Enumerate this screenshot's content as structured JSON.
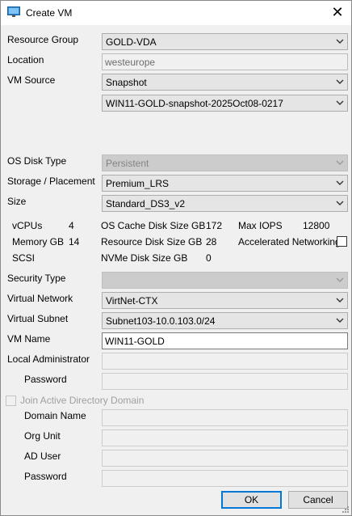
{
  "window": {
    "title": "Create VM",
    "close_glyph": "✕"
  },
  "labels": {
    "resource_group": "Resource Group",
    "location": "Location",
    "vm_source": "VM Source",
    "os_disk_type": "OS Disk Type",
    "storage_placement": "Storage / Placement",
    "size": "Size",
    "security_type": "Security Type",
    "virtual_network": "Virtual Network",
    "virtual_subnet": "Virtual Subnet",
    "vm_name": "VM Name",
    "local_admin": "Local Administrator",
    "password": "Password",
    "join_ad": "Join Active Directory Domain",
    "domain_name": "Domain Name",
    "org_unit": "Org Unit",
    "ad_user": "AD User",
    "ad_password": "Password"
  },
  "fields": {
    "resource_group": "GOLD-VDA",
    "location": "westeurope",
    "vm_source": "Snapshot",
    "snapshot": "WIN11-GOLD-snapshot-2025Oct08-0217",
    "os_disk_type": "Persistent",
    "storage": "Premium_LRS",
    "size": "Standard_DS3_v2",
    "security_type": "",
    "virtual_network": "VirtNet-CTX",
    "virtual_subnet": "Subnet103-10.0.103.0/24",
    "vm_name": "WIN11-GOLD",
    "local_admin": "",
    "password": "",
    "domain_name": "",
    "org_unit": "",
    "ad_user": "",
    "ad_password": ""
  },
  "specs": {
    "vcpus_label": "vCPUs",
    "vcpus": "4",
    "memory_label": "Memory GB",
    "memory": "14",
    "scsi_label": "SCSI",
    "os_cache_label": "OS Cache Disk Size GB",
    "os_cache": "172",
    "resource_disk_label": "Resource Disk Size GB",
    "resource_disk": "28",
    "nvme_label": "NVMe Disk Size GB",
    "nvme": "0",
    "max_iops_label": "Max IOPS",
    "max_iops": "12800",
    "accel_net_label": "Accelerated Networking"
  },
  "buttons": {
    "ok": "OK",
    "cancel": "Cancel"
  },
  "icons": {
    "app": "monitor-icon",
    "dropdown": "chevron-down-icon",
    "resize": "size-grip-icon"
  },
  "colors": {
    "default_button_border": "#0078d7",
    "app_icon": "#2a8ad4"
  }
}
